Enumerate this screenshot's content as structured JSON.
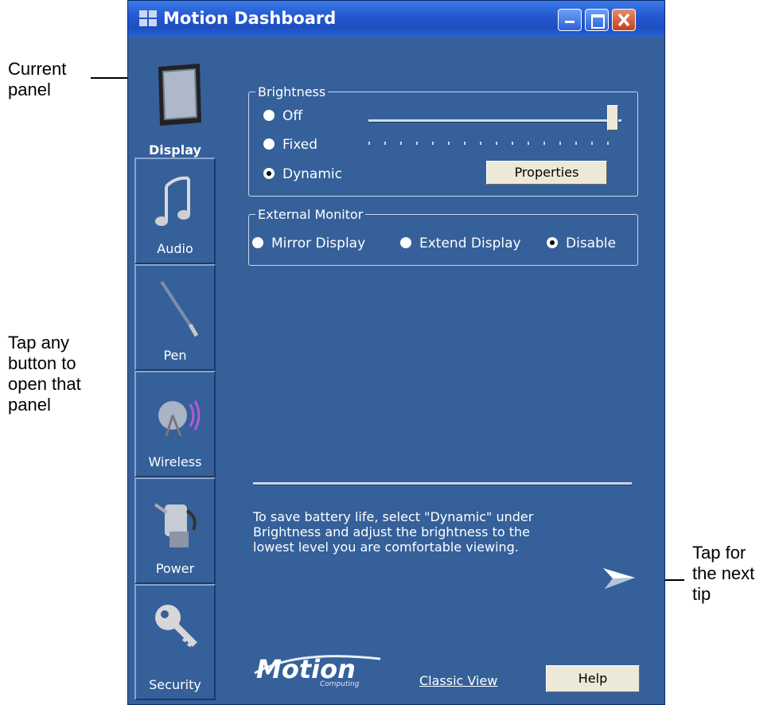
{
  "callouts": {
    "current_panel": [
      "Current",
      "panel"
    ],
    "tap_any": [
      "Tap any",
      "button to",
      "open that",
      "panel"
    ],
    "next_tip": [
      "Tap for",
      "the next",
      "tip"
    ]
  },
  "window": {
    "title": "Motion Dashboard",
    "controls": [
      "minimize-icon",
      "maximize-icon",
      "close-icon"
    ]
  },
  "nav": [
    {
      "label": "Display",
      "icon": "display-icon",
      "current": true
    },
    {
      "label": "Audio",
      "icon": "music-notes-icon"
    },
    {
      "label": "Pen",
      "icon": "pen-icon"
    },
    {
      "label": "Wireless",
      "icon": "wireless-icon"
    },
    {
      "label": "Power",
      "icon": "power-icon"
    },
    {
      "label": "Security",
      "icon": "key-icon"
    }
  ],
  "brightness": {
    "legend": "Brightness",
    "options": [
      "Off",
      "Fixed",
      "Dynamic"
    ],
    "selected": "Dynamic",
    "slider_level": 1.0,
    "properties_label": "Properties"
  },
  "external_monitor": {
    "legend": "External Monitor",
    "options": [
      "Mirror Display",
      "Extend Display",
      "Disable"
    ],
    "selected": "Disable"
  },
  "tip": {
    "lines": [
      "To save battery life, select \"Dynamic\" under",
      "Brightness and adjust the brightness to the",
      "lowest level you are comfortable viewing."
    ],
    "next_icon": "next-tip-arrow-icon"
  },
  "footer": {
    "logo": "Motion",
    "logo_sub": "Computing",
    "classic_view": "Classic View",
    "help": "Help"
  },
  "colors": {
    "panel_bg": "#35609a",
    "titlebar": "#2457cf"
  }
}
